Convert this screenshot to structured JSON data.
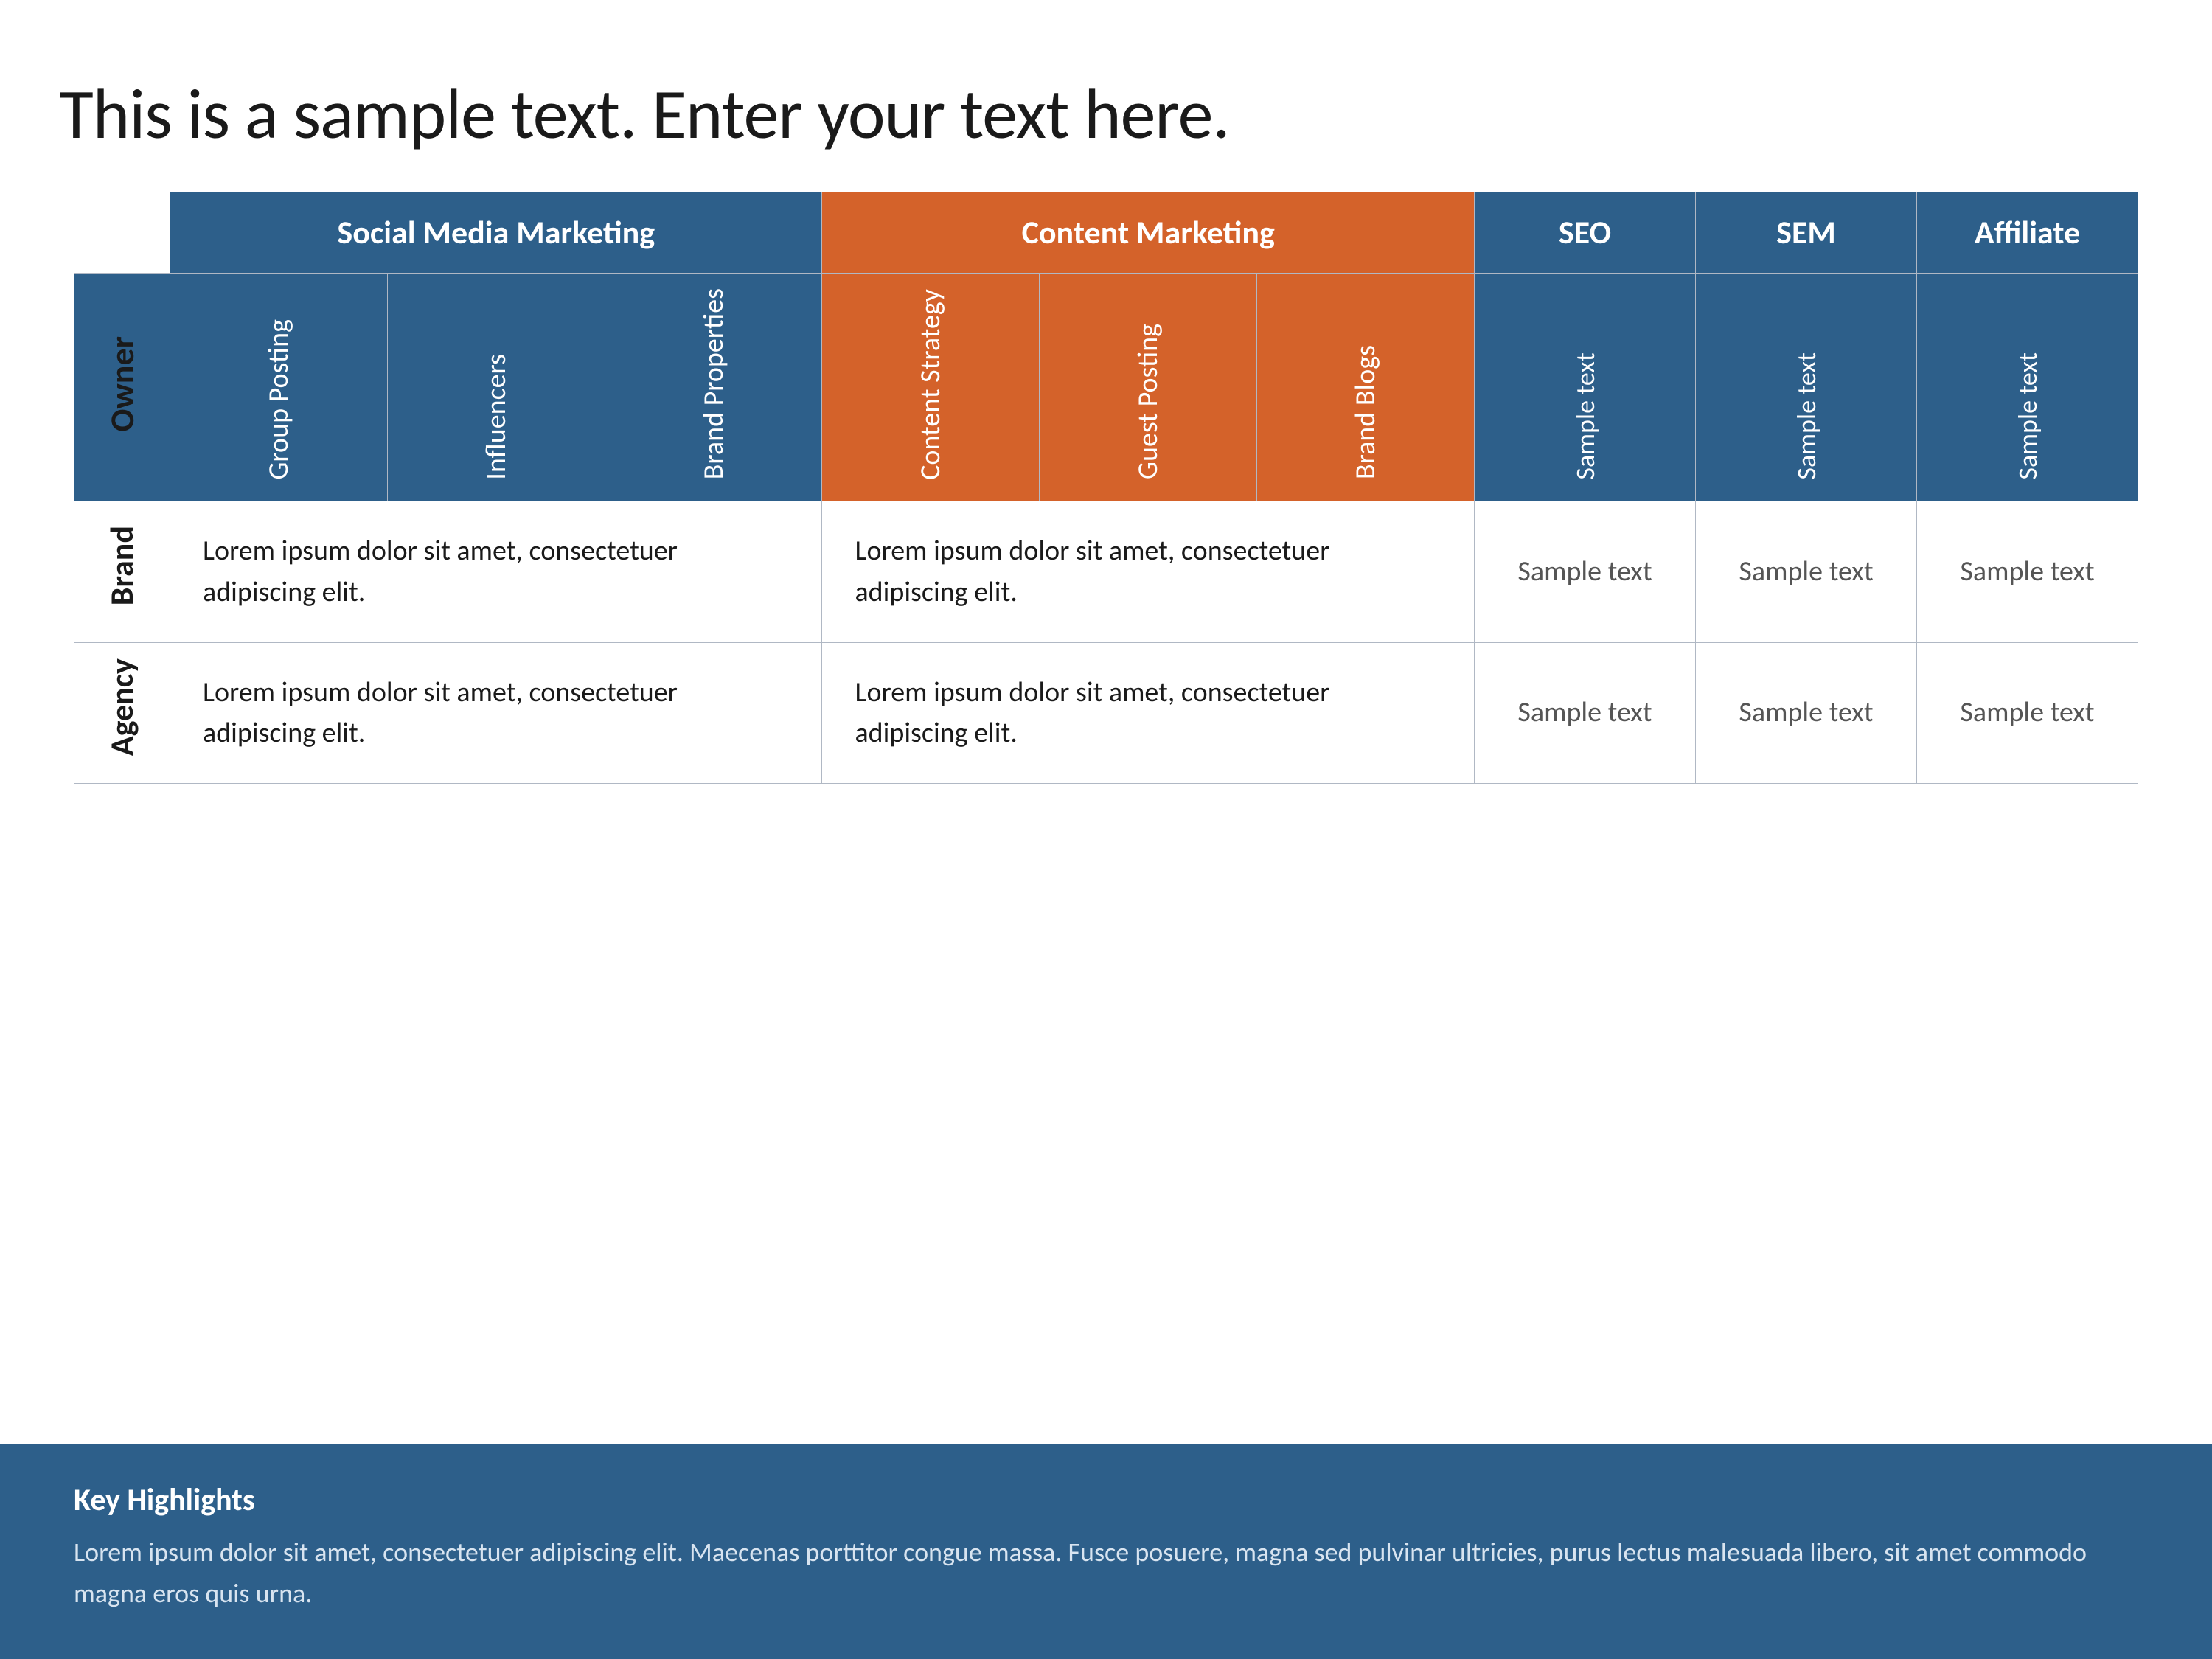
{
  "title": "This is a sample text. Enter your text here.",
  "table": {
    "headers": {
      "empty": "",
      "social_media": "Social Media Marketing",
      "content_marketing": "Content Marketing",
      "seo": "SEO",
      "sem": "SEM",
      "affiliate": "Affiliate"
    },
    "subheaders": {
      "owner_label": "Owner",
      "social_cols": [
        "Group Posting",
        "Influencers",
        "Brand Properties"
      ],
      "content_cols": [
        "Content Strategy",
        "Guest Posting",
        "Brand Blogs"
      ],
      "seo_col": "Sample text",
      "sem_col": "Sample text",
      "affiliate_col": "Sample text"
    },
    "rows": [
      {
        "label": "Brand",
        "social_text": "Lorem ipsum dolor sit amet, consectetuer adipiscing elit.",
        "content_text": "Lorem ipsum dolor sit amet, consectetuer adipiscing elit.",
        "seo_text": "Sample text",
        "sem_text": "Sample text",
        "affiliate_text": "Sample text"
      },
      {
        "label": "Agency",
        "social_text": "Lorem ipsum dolor sit amet, consectetuer adipiscing elit.",
        "content_text": "Lorem ipsum dolor sit amet, consectetuer adipiscing elit.",
        "seo_text": "Sample text",
        "sem_text": "Sample text",
        "affiliate_text": "Sample text"
      }
    ]
  },
  "footer": {
    "title": "Key Highlights",
    "text": "Lorem ipsum dolor sit amet, consectetuer adipiscing elit. Maecenas porttitor congue massa. Fusce posuere, magna sed pulvinar ultricies, purus lectus malesuada libero, sit amet commodo magna eros quis urna."
  }
}
